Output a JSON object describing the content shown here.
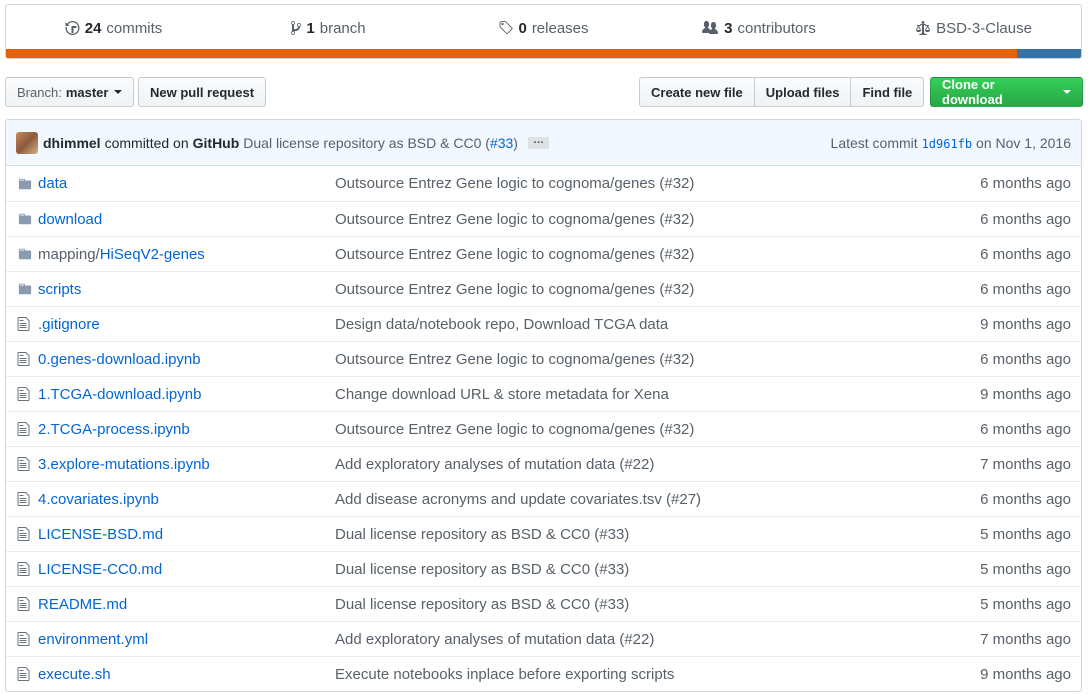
{
  "summary": {
    "commits_count": "24",
    "commits_label": "commits",
    "branches_count": "1",
    "branches_label": "branch",
    "releases_count": "0",
    "releases_label": "releases",
    "contributors_count": "3",
    "contributors_label": "contributors",
    "license": "BSD-3-Clause",
    "language_colors": [
      "#e36209",
      "#3572A5"
    ]
  },
  "toolbar": {
    "branch_prefix": "Branch:",
    "branch_name": "master",
    "new_pr": "New pull request",
    "create_file": "Create new file",
    "upload_files": "Upload files",
    "find_file": "Find file",
    "clone": "Clone or download"
  },
  "commit": {
    "author": "dhimmel",
    "committed_on": "committed on",
    "platform": "GitHub",
    "message": "Dual license repository as BSD & CC0 (",
    "pr": "#33",
    "message_end": ")",
    "ellipsis": "…",
    "latest_label": "Latest commit",
    "sha": "1d961fb",
    "date": "on Nov 1, 2016"
  },
  "files": [
    {
      "type": "dir",
      "icon": "folder-icon",
      "name": "data",
      "message": "Outsource Entrez Gene logic to cognoma/genes (#32)",
      "age": "6 months ago"
    },
    {
      "type": "dir",
      "icon": "folder-icon",
      "name": "download",
      "message": "Outsource Entrez Gene logic to cognoma/genes (#32)",
      "age": "6 months ago"
    },
    {
      "type": "dir",
      "icon": "folder-icon",
      "prefix": "mapping/",
      "name": "HiSeqV2-genes",
      "message": "Outsource Entrez Gene logic to cognoma/genes (#32)",
      "age": "6 months ago"
    },
    {
      "type": "dir",
      "icon": "folder-icon",
      "name": "scripts",
      "message": "Outsource Entrez Gene logic to cognoma/genes (#32)",
      "age": "6 months ago"
    },
    {
      "type": "file",
      "icon": "file-icon",
      "name": ".gitignore",
      "message": "Design data/notebook repo, Download TCGA data",
      "age": "9 months ago"
    },
    {
      "type": "file",
      "icon": "file-icon",
      "name": "0.genes-download.ipynb",
      "message": "Outsource Entrez Gene logic to cognoma/genes (#32)",
      "age": "6 months ago"
    },
    {
      "type": "file",
      "icon": "file-icon",
      "name": "1.TCGA-download.ipynb",
      "message": "Change download URL & store metadata for Xena",
      "age": "9 months ago"
    },
    {
      "type": "file",
      "icon": "file-icon",
      "name": "2.TCGA-process.ipynb",
      "message": "Outsource Entrez Gene logic to cognoma/genes (#32)",
      "age": "6 months ago"
    },
    {
      "type": "file",
      "icon": "file-icon",
      "name": "3.explore-mutations.ipynb",
      "message": "Add exploratory analyses of mutation data (#22)",
      "age": "7 months ago"
    },
    {
      "type": "file",
      "icon": "file-icon",
      "name": "4.covariates.ipynb",
      "message": "Add disease acronyms and update covariates.tsv (#27)",
      "age": "6 months ago"
    },
    {
      "type": "file",
      "icon": "file-icon",
      "name": "LICENSE-BSD.md",
      "message": "Dual license repository as BSD & CC0 (#33)",
      "age": "5 months ago"
    },
    {
      "type": "file",
      "icon": "file-icon",
      "name": "LICENSE-CC0.md",
      "message": "Dual license repository as BSD & CC0 (#33)",
      "age": "5 months ago"
    },
    {
      "type": "file",
      "icon": "file-icon",
      "name": "README.md",
      "message": "Dual license repository as BSD & CC0 (#33)",
      "age": "5 months ago"
    },
    {
      "type": "file",
      "icon": "file-icon",
      "name": "environment.yml",
      "message": "Add exploratory analyses of mutation data (#22)",
      "age": "7 months ago"
    },
    {
      "type": "file",
      "icon": "file-icon",
      "name": "execute.sh",
      "message": "Execute notebooks inplace before exporting scripts",
      "age": "9 months ago"
    }
  ]
}
